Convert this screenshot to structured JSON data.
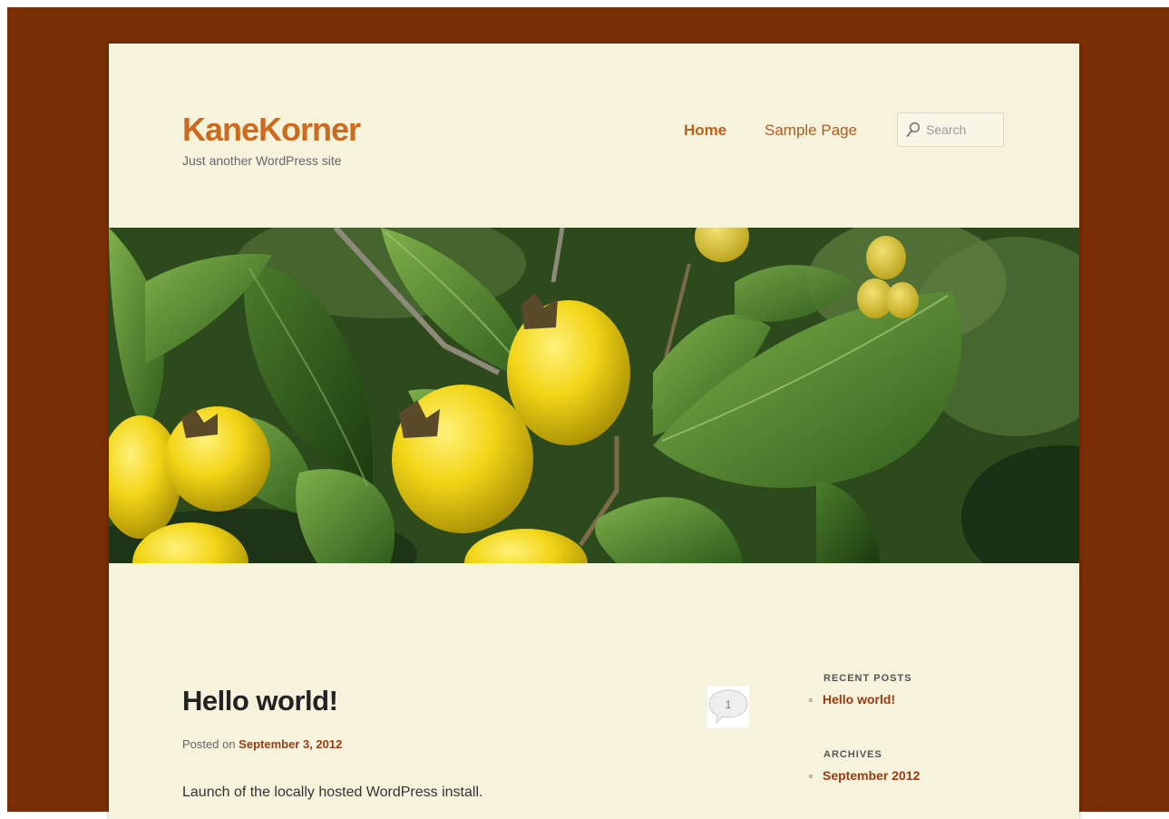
{
  "site": {
    "title": "KaneKorner",
    "description": "Just another WordPress site"
  },
  "nav": {
    "items": [
      {
        "label": "Home",
        "current": true
      },
      {
        "label": "Sample Page",
        "current": false
      }
    ]
  },
  "search": {
    "placeholder": "Search",
    "icon": "search-icon"
  },
  "post": {
    "title": "Hello world!",
    "comment_count": "1",
    "posted_on_label": "Posted on",
    "date": "September 3, 2012",
    "body": "Launch of the locally hosted WordPress install."
  },
  "sidebar": {
    "recent_posts": {
      "title": "RECENT POSTS",
      "items": [
        "Hello world!"
      ]
    },
    "archives": {
      "title": "ARCHIVES",
      "items": [
        "September 2012"
      ]
    }
  },
  "colors": {
    "outer_background": "#7a2e06",
    "page_background": "#f6f3dd",
    "site_title": "#cc6a1f",
    "link": "#9a3a14"
  }
}
